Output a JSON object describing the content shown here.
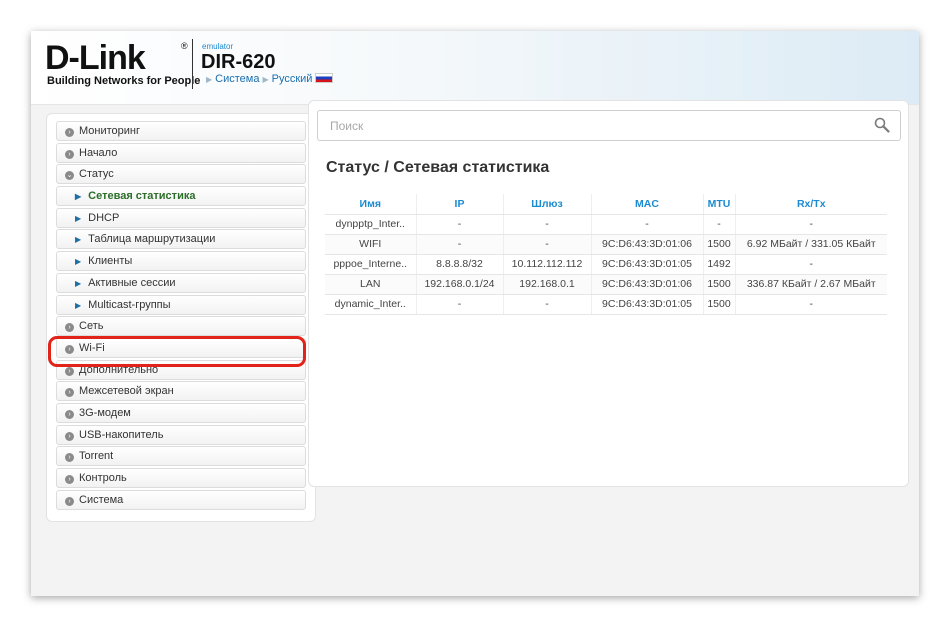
{
  "header": {
    "logo_word": "D-Link",
    "logo_reg": "®",
    "logo_tagline": "Building Networks for People",
    "emulator": "emulator",
    "model": "DIR-620",
    "crumb_system": "Система",
    "crumb_language": "Русский"
  },
  "sidebar": {
    "items": [
      {
        "label": "Мониторинг"
      },
      {
        "label": "Начало"
      },
      {
        "label": "Статус"
      },
      {
        "label": "Сетевая статистика"
      },
      {
        "label": "DHCP"
      },
      {
        "label": "Таблица маршрутизации"
      },
      {
        "label": "Клиенты"
      },
      {
        "label": "Активные сессии"
      },
      {
        "label": "Multicast-группы"
      },
      {
        "label": "Сеть"
      },
      {
        "label": "Wi-Fi"
      },
      {
        "label": "Дополнительно"
      },
      {
        "label": "Межсетевой экран"
      },
      {
        "label": "3G-модем"
      },
      {
        "label": "USB-накопитель"
      },
      {
        "label": "Torrent"
      },
      {
        "label": "Контроль"
      },
      {
        "label": "Система"
      }
    ]
  },
  "search": {
    "placeholder": "Поиск"
  },
  "page": {
    "title": "Статус /  Сетевая статистика"
  },
  "table": {
    "headers": [
      "Имя",
      "IP",
      "Шлюз",
      "MAC",
      "MTU",
      "Rx/Tx"
    ],
    "rows": [
      [
        "dynpptp_Inter..",
        "-",
        "-",
        "-",
        "-",
        "-"
      ],
      [
        "WIFI",
        "-",
        "-",
        "9C:D6:43:3D:01:06",
        "1500",
        "6.92 МБайт / 331.05 КБайт"
      ],
      [
        "pppoe_Interne..",
        "8.8.8.8/32",
        "10.112.112.112",
        "9C:D6:43:3D:01:05",
        "1492",
        "-"
      ],
      [
        "LAN",
        "192.168.0.1/24",
        "192.168.0.1",
        "9C:D6:43:3D:01:06",
        "1500",
        "336.87 КБайт / 2.67 МБайт"
      ],
      [
        "dynamic_Inter..",
        "-",
        "-",
        "9C:D6:43:3D:01:05",
        "1500",
        "-"
      ]
    ]
  },
  "colors": {
    "accent": "#1b8ad1",
    "inactive_iface": "#e2231a",
    "active_iface": "#2a8a1f",
    "highlight": "#e2231a"
  }
}
